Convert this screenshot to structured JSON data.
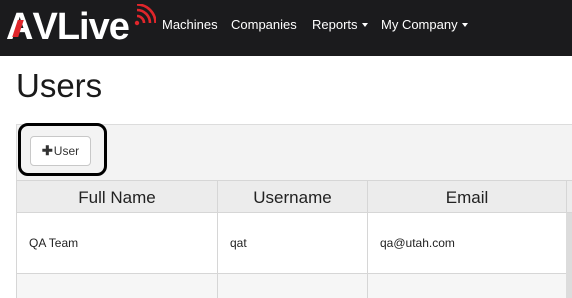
{
  "brand": {
    "logo_text_left": "AV",
    "logo_text_mark": "A",
    "logo_text_right": "Live",
    "accent_color": "#e0262b",
    "icon": "signal-waves-icon"
  },
  "nav": {
    "items": [
      {
        "label": "Machines",
        "dropdown": false
      },
      {
        "label": "Companies",
        "dropdown": false
      },
      {
        "label": "Reports",
        "dropdown": true
      },
      {
        "label": "My Company",
        "dropdown": true
      }
    ]
  },
  "page": {
    "title": "Users"
  },
  "toolbar": {
    "add_user_label": "User",
    "add_user_icon": "plus-icon"
  },
  "table": {
    "columns": [
      "Full Name",
      "Username",
      "Email"
    ],
    "rows": [
      {
        "full_name": "QA Team",
        "username": "qat",
        "email": "qa@utah.com"
      },
      {
        "full_name": "",
        "username": "",
        "email": ""
      }
    ]
  }
}
